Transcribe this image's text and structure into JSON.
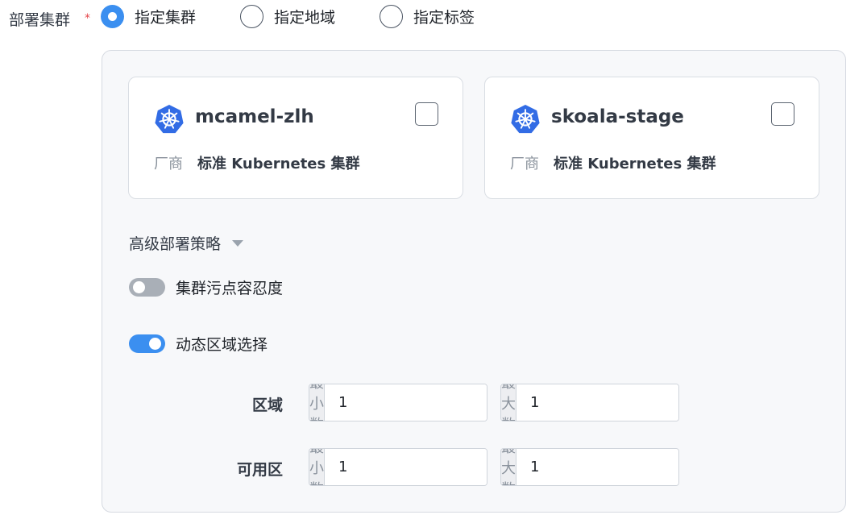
{
  "deploy": {
    "label": "部署集群",
    "required_mark": "*",
    "options": [
      {
        "label": "指定集群",
        "checked": true
      },
      {
        "label": "指定地域",
        "checked": false
      },
      {
        "label": "指定标签",
        "checked": false
      }
    ]
  },
  "clusters": [
    {
      "name": "mcamel-zlh",
      "vendor_label": "厂商",
      "vendor_value": "标准 Kubernetes 集群",
      "checked": false,
      "icon": "kubernetes-icon"
    },
    {
      "name": "skoala-stage",
      "vendor_label": "厂商",
      "vendor_value": "标准 Kubernetes 集群",
      "checked": false,
      "icon": "kubernetes-icon"
    }
  ],
  "advanced": {
    "label": "高级部署策略",
    "taint_toleration": {
      "label": "集群污点容忍度",
      "enabled": false
    },
    "dynamic_zone": {
      "label": "动态区域选择",
      "enabled": true
    }
  },
  "ranges": [
    {
      "label": "区域",
      "min_prefix": "最小数",
      "min_value": "1",
      "max_prefix": "最大数",
      "max_value": "1"
    },
    {
      "label": "可用区",
      "min_prefix": "最小数",
      "min_value": "1",
      "max_prefix": "最大数",
      "max_value": "1"
    }
  ],
  "colors": {
    "accent": "#3b8ff0",
    "required": "#e5484d",
    "kubernetes": "#326ce5"
  }
}
